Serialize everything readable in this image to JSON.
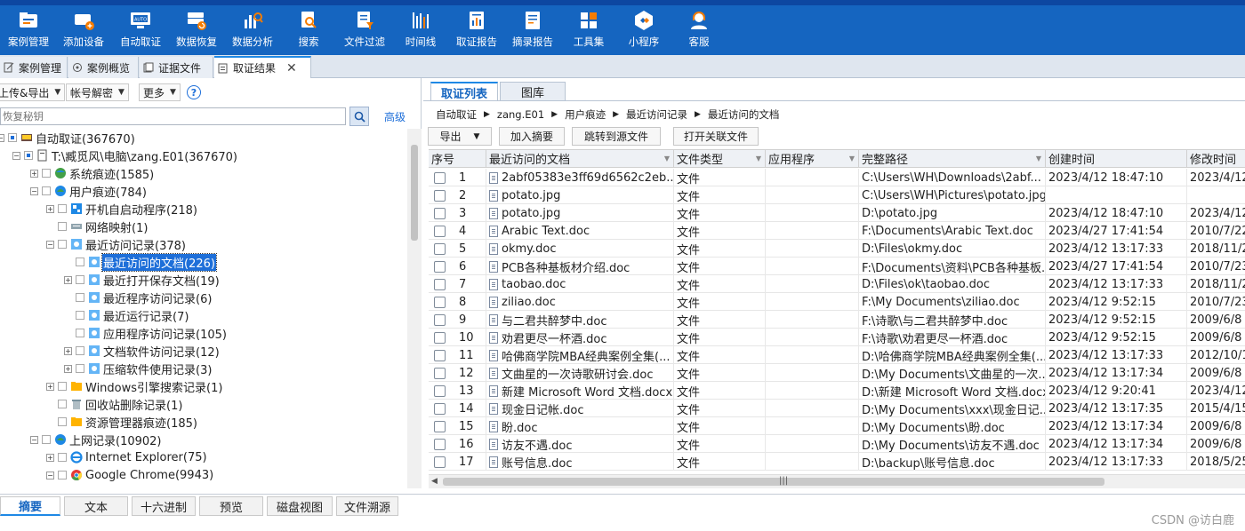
{
  "colors": {
    "ribbon": "#1565c0",
    "accent": "#1e6fd9",
    "selection": "#1e6fd9"
  },
  "toolbar": {
    "items": [
      {
        "label": "案例管理",
        "icon": "folder-case-icon"
      },
      {
        "label": "添加设备",
        "icon": "add-device-icon"
      },
      {
        "label": "自动取证",
        "icon": "auto-forensics-icon"
      },
      {
        "label": "数据恢复",
        "icon": "data-recovery-icon"
      },
      {
        "label": "数据分析",
        "icon": "data-analysis-icon"
      },
      {
        "label": "搜索",
        "icon": "search-doc-icon"
      },
      {
        "label": "文件过滤",
        "icon": "file-filter-icon"
      },
      {
        "label": "时间线",
        "icon": "timeline-icon"
      },
      {
        "label": "取证报告",
        "icon": "forensic-report-icon"
      },
      {
        "label": "摘录报告",
        "icon": "excerpt-report-icon"
      },
      {
        "label": "工具集",
        "icon": "toolset-icon"
      },
      {
        "label": "小程序",
        "icon": "mini-program-icon"
      },
      {
        "label": "客服",
        "icon": "customer-service-icon"
      }
    ]
  },
  "doc_tabs": [
    {
      "label": "案例管理",
      "icon": "edit-icon"
    },
    {
      "label": "案例概览",
      "icon": "overview-icon"
    },
    {
      "label": "证据文件",
      "icon": "evidence-file-icon"
    },
    {
      "label": "取证结果",
      "icon": "result-icon",
      "active": true
    }
  ],
  "left": {
    "dropdowns": [
      "上传&导出",
      "帐号解密",
      "更多"
    ],
    "help": "?",
    "search_placeholder": "恢复秘钥",
    "advanced_link": "高级",
    "tree": [
      {
        "label": "自动取证(367670)",
        "icon": "computer-icon"
      },
      {
        "label": "T:\\臧觅风\\电脑\\zang.E01(367670)",
        "icon": "disk-image-icon"
      },
      {
        "label": "系统痕迹(1585)",
        "icon": "globe-icon"
      },
      {
        "label": "用户痕迹(784)",
        "icon": "globe-icon"
      },
      {
        "label": "开机自启动程序(218)",
        "icon": "startup-icon"
      },
      {
        "label": "网络映射(1)",
        "icon": "network-icon"
      },
      {
        "label": "最近访问记录(378)",
        "icon": "record-icon"
      },
      {
        "label": "最近访问的文档(226)",
        "icon": "record-icon"
      },
      {
        "label": "最近打开保存文档(19)",
        "icon": "record-icon"
      },
      {
        "label": "最近程序访问记录(6)",
        "icon": "record-icon"
      },
      {
        "label": "最近运行记录(7)",
        "icon": "record-icon"
      },
      {
        "label": "应用程序访问记录(105)",
        "icon": "record-icon"
      },
      {
        "label": "文档软件访问记录(12)",
        "icon": "record-icon"
      },
      {
        "label": "压缩软件使用记录(3)",
        "icon": "record-icon"
      },
      {
        "label": "Windows引擎搜索记录(1)",
        "icon": "folder-icon"
      },
      {
        "label": "回收站删除记录(1)",
        "icon": "recycle-bin-icon"
      },
      {
        "label": "资源管理器痕迹(185)",
        "icon": "folder-icon"
      },
      {
        "label": "上网记录(10902)",
        "icon": "globe-icon"
      },
      {
        "label": "Internet Explorer(75)",
        "icon": "ie-icon"
      },
      {
        "label": "Google Chrome(9943)",
        "icon": "chrome-icon"
      }
    ]
  },
  "right": {
    "tabs": [
      "取证列表",
      "图库"
    ],
    "breadcrumb": [
      "自动取证",
      "zang.E01",
      "用户痕迹",
      "最近访问记录",
      "最近访问的文档"
    ],
    "actions": [
      "导出",
      "加入摘要",
      "跳转到源文件",
      "打开关联文件"
    ],
    "columns": [
      "序号",
      "最近访问的文档",
      "文件类型",
      "应用程序",
      "完整路径",
      "创建时间",
      "修改时间"
    ],
    "rows": [
      [
        "1",
        "2abf05383e3ff69d6562c2eb...",
        "文件",
        "",
        "C:\\Users\\WH\\Downloads\\2abf...",
        "2023/4/12 18:47:10",
        "2023/4/12"
      ],
      [
        "2",
        "potato.jpg",
        "文件",
        "",
        "C:\\Users\\WH\\Pictures\\potato.jpg",
        "",
        ""
      ],
      [
        "3",
        "potato.jpg",
        "文件",
        "",
        "D:\\potato.jpg",
        "2023/4/12 18:47:10",
        "2023/4/12"
      ],
      [
        "4",
        "Arabic Text.doc",
        "文件",
        "",
        "F:\\Documents\\Arabic Text.doc",
        "2023/4/27 17:41:54",
        "2010/7/22"
      ],
      [
        "5",
        "okmy.doc",
        "文件",
        "",
        "D:\\Files\\okmy.doc",
        "2023/4/12 13:17:33",
        "2018/11/29"
      ],
      [
        "6",
        "PCB各种基板材介绍.doc",
        "文件",
        "",
        "F:\\Documents\\资料\\PCB各种基板...",
        "2023/4/27 17:41:54",
        "2010/7/23"
      ],
      [
        "7",
        "taobao.doc",
        "文件",
        "",
        "D:\\Files\\ok\\taobao.doc",
        "2023/4/12 13:17:33",
        "2018/11/29"
      ],
      [
        "8",
        "ziliao.doc",
        "文件",
        "",
        "F:\\My Documents\\ziliao.doc",
        "2023/4/12 9:52:15",
        "2010/7/23"
      ],
      [
        "9",
        "与二君共醉梦中.doc",
        "文件",
        "",
        "F:\\诗歌\\与二君共醉梦中.doc",
        "2023/4/12 9:52:15",
        "2009/6/8 6"
      ],
      [
        "10",
        "劝君更尽一杯酒.doc",
        "文件",
        "",
        "F:\\诗歌\\劝君更尽一杯酒.doc",
        "2023/4/12 9:52:15",
        "2009/6/8 8"
      ],
      [
        "11",
        "哈佛商学院MBA经典案例全集(...",
        "文件",
        "",
        "D:\\哈佛商学院MBA经典案例全集(...",
        "2023/4/12 13:17:33",
        "2012/10/18"
      ],
      [
        "12",
        "文曲星的一次诗歌研讨会.doc",
        "文件",
        "",
        "D:\\My Documents\\文曲星的一次...",
        "2023/4/12 13:17:34",
        "2009/6/8 5"
      ],
      [
        "13",
        "新建 Microsoft Word 文档.docx",
        "文件",
        "",
        "D:\\新建 Microsoft Word 文档.docx",
        "2023/4/12 9:20:41",
        "2023/4/12"
      ],
      [
        "14",
        "现金日记帐.doc",
        "文件",
        "",
        "D:\\My Documents\\xxx\\现金日记...",
        "2023/4/12 13:17:35",
        "2015/4/15"
      ],
      [
        "15",
        "盼.doc",
        "文件",
        "",
        "D:\\My Documents\\盼.doc",
        "2023/4/12 13:17:34",
        "2009/6/8 7"
      ],
      [
        "16",
        "访友不遇.doc",
        "文件",
        "",
        "D:\\My Documents\\访友不遇.doc",
        "2023/4/12 13:17:34",
        "2009/6/8 4"
      ],
      [
        "17",
        "账号信息.doc",
        "文件",
        "",
        "D:\\backup\\账号信息.doc",
        "2023/4/12 13:17:33",
        "2018/5/25"
      ]
    ]
  },
  "bottom_tabs": [
    "摘要",
    "文本",
    "十六进制",
    "预览",
    "磁盘视图",
    "文件溯源"
  ],
  "watermark": "CSDN @访白鹿"
}
